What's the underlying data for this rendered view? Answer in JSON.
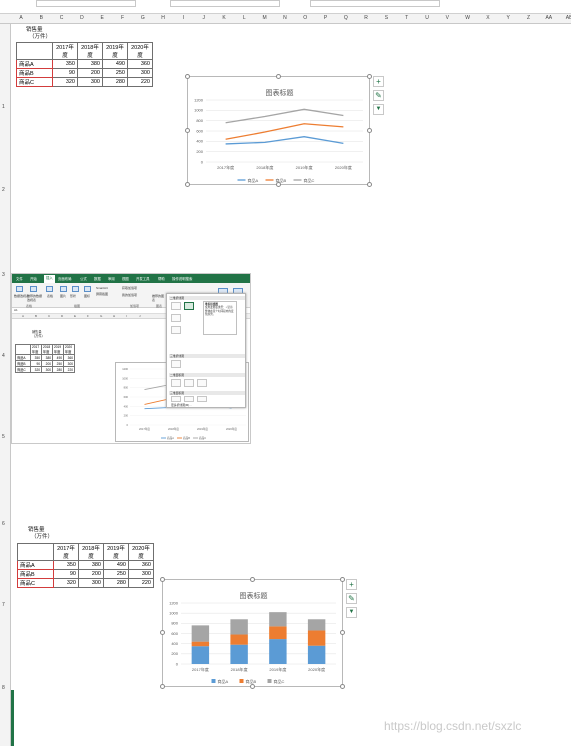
{
  "sheet": {
    "column_letters": [
      "A",
      "B",
      "C",
      "D",
      "E",
      "F",
      "G",
      "H",
      "I",
      "J",
      "K",
      "L",
      "M",
      "N",
      "O",
      "P",
      "Q",
      "R",
      "S",
      "T",
      "U",
      "V",
      "W",
      "X",
      "Y",
      "Z",
      "AA",
      "AB"
    ],
    "row_markers": [
      "1",
      "2",
      "3",
      "4",
      "5",
      "6",
      "7",
      "8"
    ]
  },
  "table_top": {
    "title_line1": "销售量",
    "title_line2": "（万件）",
    "headers": [
      "2017年度",
      "2018年度",
      "2019年度",
      "2020年度"
    ],
    "rows": [
      {
        "label": "商品A",
        "values": [
          "350",
          "380",
          "490",
          "360"
        ]
      },
      {
        "label": "商品B",
        "values": [
          "90",
          "200",
          "250",
          "300"
        ]
      },
      {
        "label": "商品C",
        "values": [
          "320",
          "300",
          "280",
          "220"
        ]
      }
    ]
  },
  "table_bottom": {
    "title_line1": "销售量",
    "title_line2": "（万件）",
    "headers": [
      "2017年度",
      "2018年度",
      "2019年度",
      "2020年度"
    ],
    "rows": [
      {
        "label": "商品A",
        "values": [
          "350",
          "380",
          "490",
          "360"
        ]
      },
      {
        "label": "商品B",
        "values": [
          "90",
          "200",
          "250",
          "300"
        ]
      },
      {
        "label": "商品C",
        "values": [
          "320",
          "300",
          "280",
          "220"
        ]
      }
    ]
  },
  "chart_side_buttons": {
    "plus": "+",
    "brush": "✎",
    "filter": "▼"
  },
  "chart_data": [
    {
      "type": "line",
      "title": "图表标题",
      "categories": [
        "2017年度",
        "2018年度",
        "2019年度",
        "2020年度"
      ],
      "series": [
        {
          "name": "商品A",
          "color": "#5b9bd5",
          "values": [
            350,
            380,
            490,
            360
          ]
        },
        {
          "name": "商品B",
          "color": "#ed7d31",
          "values": [
            440,
            580,
            740,
            680
          ]
        },
        {
          "name": "商品C",
          "color": "#a5a5a5",
          "values": [
            760,
            880,
            1020,
            900
          ]
        }
      ],
      "ylim": [
        0,
        1200
      ],
      "yticks": [
        "0",
        "200",
        "400",
        "600",
        "800",
        "1000",
        "1200"
      ],
      "legend": "bottom",
      "grid": true
    },
    {
      "type": "bar",
      "stacked": true,
      "title": "图表标题",
      "categories": [
        "2017年度",
        "2018年度",
        "2019年度",
        "2020年度"
      ],
      "series": [
        {
          "name": "商品A",
          "color": "#5b9bd5",
          "values": [
            350,
            380,
            490,
            360
          ]
        },
        {
          "name": "商品B",
          "color": "#ed7d31",
          "values": [
            90,
            200,
            250,
            300
          ]
        },
        {
          "name": "商品C",
          "color": "#a5a5a5",
          "values": [
            320,
            300,
            280,
            220
          ]
        }
      ],
      "ylim": [
        0,
        1200
      ],
      "yticks": [
        "0",
        "200",
        "400",
        "600",
        "800",
        "1000",
        "1200"
      ],
      "legend": "bottom",
      "grid": true
    }
  ],
  "mini_screenshot": {
    "tabs": [
      "文件",
      "开始",
      "插入",
      "页面布局",
      "公式",
      "数据",
      "审阅",
      "视图",
      "开发工具",
      "帮助",
      "操作说明搜索"
    ],
    "active_tab": "插入",
    "groups": [
      "表格",
      "插图",
      "加载项",
      "图表"
    ],
    "buttons": [
      "数据透视表",
      "推荐的数据透视表",
      "表格",
      "图片",
      "形状",
      "图标",
      "SmartArt",
      "屏幕截图",
      "获取加载项",
      "我的加载项",
      "推荐的图表"
    ],
    "name_box": "A1",
    "dropdown_sections": [
      "二维折线图",
      "三维折线图",
      "二维面积图",
      "三维面积图"
    ],
    "tooltip_title": "堆积折线图",
    "tooltip_text": "使用此图表类型：• 显示整体在某个时间段内的变化趋势。",
    "more_charts": "更多折线图(M)...",
    "table": {
      "title_line1": "销售量",
      "title_line2": "（万件）",
      "headers": [
        "2017年度",
        "2018年度",
        "2019年度",
        "2020年度"
      ],
      "rows": [
        {
          "label": "商品A",
          "values": [
            "350",
            "380",
            "490",
            "360"
          ]
        },
        {
          "label": "商品B",
          "values": [
            "90",
            "200",
            "250",
            "300"
          ]
        },
        {
          "label": "商品C",
          "values": [
            "320",
            "300",
            "280",
            "220"
          ]
        }
      ]
    },
    "chart_categories": [
      "2017年度",
      "2018年度",
      "2019年度",
      "2020年度"
    ],
    "chart_legend": [
      "商品A",
      "商品B",
      "商品C"
    ]
  },
  "watermark": "https://blog.csdn.net/sxzlc"
}
